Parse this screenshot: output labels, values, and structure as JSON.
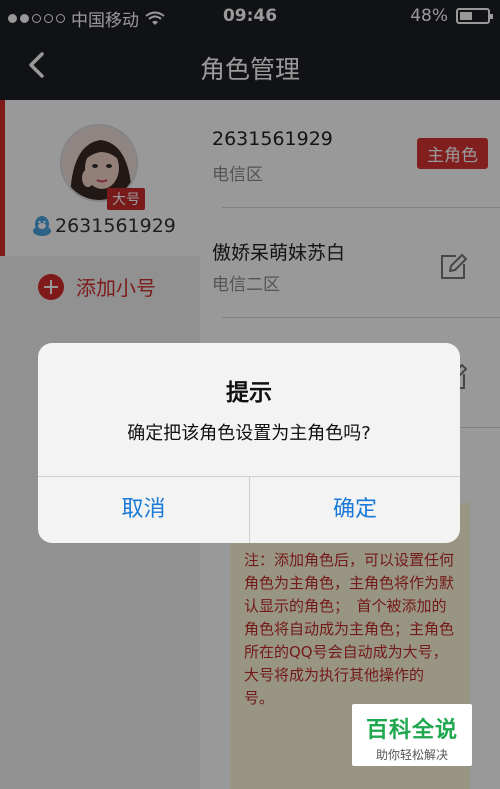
{
  "status_bar": {
    "carrier": "中国移动",
    "time": "09:46",
    "battery_percent": "48%",
    "battery_level": 0.48
  },
  "navbar": {
    "back_icon": "chevron-left-icon",
    "title": "角色管理"
  },
  "left_panel": {
    "account_badge": "大号",
    "qq_number": "2631561929",
    "add_sub_label": "添加小号"
  },
  "roles": [
    {
      "name": "2631561929",
      "zone": "电信区",
      "badge": "主角色"
    },
    {
      "name": "傲娇呆萌妹苏白",
      "zone": "电信二区"
    }
  ],
  "note_text": "注：添加角色后，可以设置任何角色为主角色，主角色将作为默认显示的角色；　首个被添加的角色将自动成为主角色；主角色所在的QQ号会自动成为大号，大号将成为执行其他操作的　　　　　号。",
  "alert": {
    "title": "提示",
    "message": "确定把该角色设置为主角色吗?",
    "cancel": "取消",
    "confirm": "确定"
  },
  "watermark": {
    "main": "百科全说",
    "sub": "助你轻松解决"
  },
  "colors": {
    "accent": "#d62b2b",
    "ios_blue": "#1a7ad8",
    "watermark_green": "#1fa84f"
  }
}
